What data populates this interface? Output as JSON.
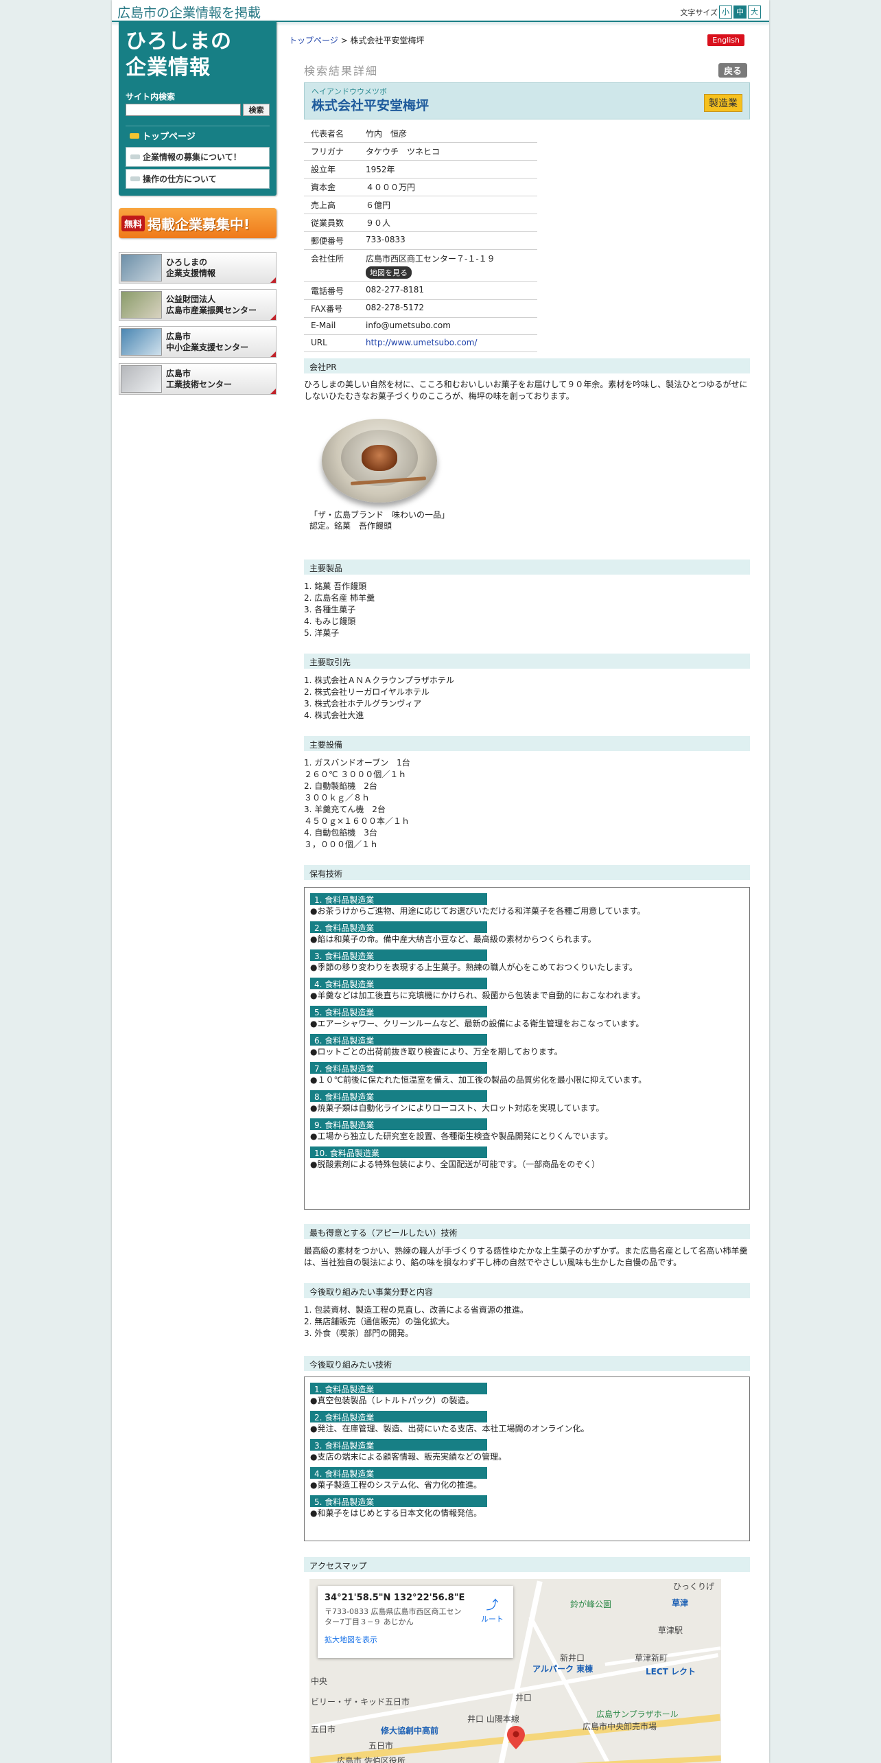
{
  "header": {
    "tagline": "広島市の企業情報を掲載",
    "font_size_label": "文字サイズ",
    "font_sizes": [
      "小",
      "中",
      "大"
    ]
  },
  "sidebar": {
    "logo_line1": "ひろしまの",
    "logo_line2": "企業情報",
    "search_label": "サイト内検索",
    "search_value": "",
    "search_button": "検索",
    "nav_top": "トップページ",
    "nav_items": [
      "企業情報の募集について！",
      "操作の仕方について"
    ],
    "banner_free_badge": "無料",
    "banner_free_text": "掲載企業募集中!",
    "links": [
      {
        "line1": "ひろしまの",
        "line2": "企業支援情報"
      },
      {
        "line1": "公益財団法人",
        "line2": "広島市産業振興センター"
      },
      {
        "line1": "広島市",
        "line2": "中小企業支援センター"
      },
      {
        "line1": "広島市",
        "line2": "工業技術センター"
      }
    ]
  },
  "breadcrumb": {
    "home": "トップページ",
    "sep": " > ",
    "current": "株式会社平安堂梅坪"
  },
  "english_button": "English",
  "section_title": "検索結果詳細",
  "back_button": "戻る",
  "company": {
    "ruby": "ヘイアンドウウメツボ",
    "name": "株式会社平安堂梅坪",
    "category": "製造業"
  },
  "info": [
    {
      "k": "代表者名",
      "v": "竹内　恒彦"
    },
    {
      "k": "フリガナ",
      "v": "タケウチ　ツネヒコ"
    },
    {
      "k": "設立年",
      "v": "1952年"
    },
    {
      "k": "資本金",
      "v": "４０００万円"
    },
    {
      "k": "売上高",
      "v": "６億円"
    },
    {
      "k": "従業員数",
      "v": "９０人"
    },
    {
      "k": "郵便番号",
      "v": "733-0833"
    },
    {
      "k": "会社住所",
      "v": "広島市西区商工センター７-１-１９"
    },
    {
      "k": "電話番号",
      "v": "082-277-8181"
    },
    {
      "k": "FAX番号",
      "v": "082-278-5172"
    },
    {
      "k": "E-Mail",
      "v": "info@umetsubo.com"
    },
    {
      "k": "URL",
      "v": "http://www.umetsubo.com/"
    }
  ],
  "map_button": "地図を見る",
  "pr": {
    "heading": "会社PR",
    "text": "ひろしまの美しい自然を材に、こころ和むおいしいお菓子をお届けして９０年余。素材を吟味し、製法ひとつゆるがせにしないひたむきなお菓子づくりのこころが、梅坪の味を創っております。",
    "caption": "「ザ・広島ブランド　味わいの一品」認定。銘菓　吾作饅頭"
  },
  "products": {
    "heading": "主要製品",
    "items": [
      "1. 銘菓 吾作饅頭",
      "2. 広島名産 柿羊羹",
      "3. 各種生菓子",
      "4. もみじ饅頭",
      "5. 洋菓子"
    ]
  },
  "clients": {
    "heading": "主要取引先",
    "items": [
      "1. 株式会社ＡＮＡクラウンプラザホテル",
      "2. 株式会社リーガロイヤルホテル",
      "3. 株式会社ホテルグランヴィア",
      "4. 株式会社大進"
    ]
  },
  "equipment": {
    "heading": "主要設備",
    "items": [
      "1. ガスバンドオーブン　1台",
      "２６０℃ ３０００個／１ｈ",
      "2. 自動製餡機　2台",
      "３００ｋｇ／８ｈ",
      "3. 羊羹充てん機　2台",
      "４５０ｇ×１６００本／１ｈ",
      "4. 自動包餡機　3台",
      "３，０００個／１ｈ"
    ]
  },
  "tech": {
    "heading": "保有技術",
    "items": [
      {
        "label": "1. 食料品製造業",
        "desc": "●お茶うけからご進物、用途に応じてお選びいただける和洋菓子を各種ご用意しています。"
      },
      {
        "label": "2. 食料品製造業",
        "desc": "●餡は和菓子の命。備中産大納言小豆など、最高級の素材からつくられます。"
      },
      {
        "label": "3. 食料品製造業",
        "desc": "●季節の移り変わりを表現する上生菓子。熟練の職人が心をこめておつくりいたします。"
      },
      {
        "label": "4. 食料品製造業",
        "desc": "●羊羹などは加工後直ちに充填機にかけられ、殺菌から包装まで自動的におこなわれます。"
      },
      {
        "label": "5. 食料品製造業",
        "desc": "●エアーシャワー、クリーンルームなど、最新の設備による衛生管理をおこなっています。"
      },
      {
        "label": "6. 食料品製造業",
        "desc": "●ロットごとの出荷前抜き取り検査により、万全を期しております。"
      },
      {
        "label": "7. 食料品製造業",
        "desc": "●１０℃前後に保たれた恒温室を備え、加工後の製品の品質劣化を最小限に抑えています。"
      },
      {
        "label": "8. 食料品製造業",
        "desc": "●焼菓子類は自動化ラインによりローコスト、大ロット対応を実現しています。"
      },
      {
        "label": "9. 食料品製造業",
        "desc": "●工場から独立した研究室を設置、各種衛生検査や製品開発にとりくんでいます。"
      },
      {
        "label": "10. 食料品製造業",
        "desc": "●脱酸素剤による特殊包装により、全国配送が可能です。（一部商品をのぞく）"
      }
    ]
  },
  "appeal": {
    "heading": "最も得意とする（アピールしたい）技術",
    "text": "最高級の素材をつかい、熟練の職人が手づくりする感性ゆたかな上生菓子のかずかず。また広島名産として名高い柿羊羹は、当社独自の製法により、餡の味を損なわず干し柿の自然でやさしい風味も生かした自慢の品です。"
  },
  "future_fields": {
    "heading": "今後取り組みたい事業分野と内容",
    "items": [
      "1. 包装資材、製造工程の見直し、改善による省資源の推進。",
      "2. 無店舗販売（通信販売）の強化拡大。",
      "3. 外食（喫茶）部門の開発。"
    ]
  },
  "future_tech": {
    "heading": "今後取り組みたい技術",
    "items": [
      {
        "label": "1. 食料品製造業",
        "desc": "●真空包装製品（レトルトパック）の製造。"
      },
      {
        "label": "2. 食料品製造業",
        "desc": "●発注、在庫管理、製造、出荷にいたる支店、本社工場間のオンライン化。"
      },
      {
        "label": "3. 食料品製造業",
        "desc": "●支店の端末による顧客情報、販売実績などの管理。"
      },
      {
        "label": "4. 食料品製造業",
        "desc": "●菓子製造工程のシステム化、省力化の推進。"
      },
      {
        "label": "5. 食料品製造業",
        "desc": "●和菓子をはじめとする日本文化の情報発信。"
      }
    ]
  },
  "access": {
    "heading": "アクセスマップ",
    "coord": "34°21'58.5\"N 132°22'56.8\"E",
    "addr": "〒733-0833 広島県広島市西区商工センター7丁目３−９ あじかん",
    "big_map": "拡大地図を表示",
    "route": "ルート",
    "labels": [
      "ひっくりげ",
      "鈴が峰公園",
      "草津",
      "草津駅",
      "新井口",
      "アルパーク 東棟",
      "草津新町",
      "LECT レクト",
      "井口",
      "ビリー・ザ・キッド五日市",
      "修大協創中高前",
      "井口 山陽本線",
      "広島サンプラザホール",
      "広島市中央卸売市場",
      "五日市",
      "五日市",
      "広島市 佐伯区役所",
      "中央"
    ]
  }
}
